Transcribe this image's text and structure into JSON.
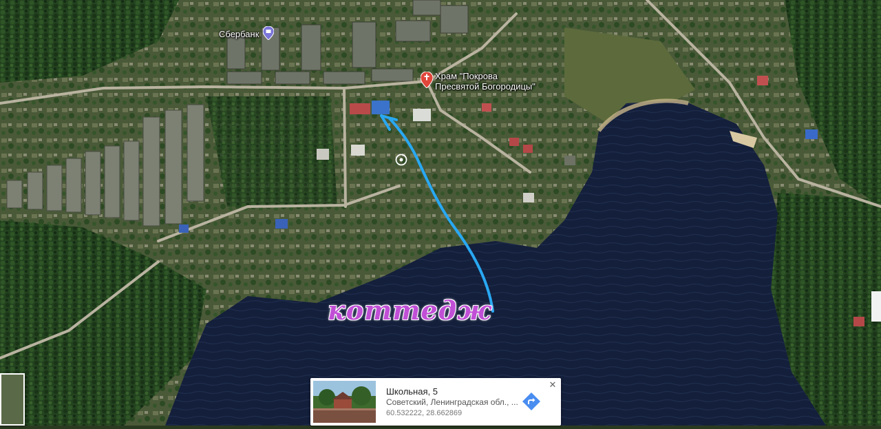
{
  "map": {
    "view": "satellite",
    "water_color": "#141f3b",
    "forest_color": "#1d3a1f"
  },
  "pois": {
    "sberbank": {
      "label": "Сбербанк",
      "icon": "bank-pin-icon",
      "color": "#7a75d8"
    },
    "church": {
      "label_line1": "Храм \"Покрова",
      "label_line2": "Пресвятой Богородицы\"",
      "icon": "church-pin-icon",
      "color": "#e0463a"
    }
  },
  "annotation": {
    "text": "коттедж",
    "text_color": "#c14fd6",
    "arrow_color": "#29a8f2"
  },
  "info_card": {
    "title": "Школьная, 5",
    "address": "Советский, Ленинградская обл., ...",
    "coords": "60.532222, 28.662869",
    "close_icon": "close-icon",
    "directions_icon": "directions-icon",
    "directions_color": "#4a8df0"
  }
}
